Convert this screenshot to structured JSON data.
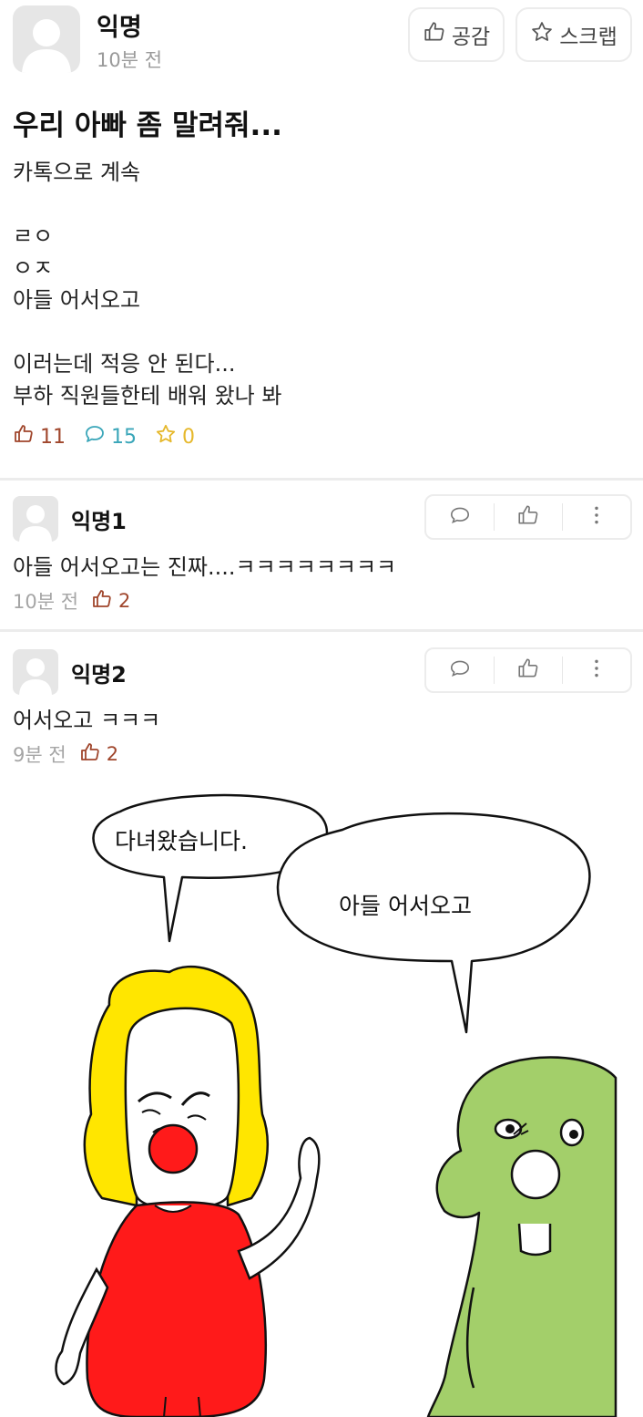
{
  "post": {
    "author": "익명",
    "time": "10분 전",
    "like_button": "공감",
    "scrap_button": "스크랩",
    "title": "우리 아빠 좀 말려줘...",
    "body_lines": [
      "카톡으로 계속",
      "",
      "ㄹㅇ",
      "ㅇㅈ",
      "아들 어서오고",
      "",
      "이러는데 적응 안 된다...",
      "부하 직원들한테 배워 왔나 봐"
    ],
    "stats": {
      "likes": "11",
      "comments": "15",
      "scraps": "0"
    }
  },
  "comments": [
    {
      "author": "익명1",
      "text": "아들 어서오고는 진짜....ㅋㅋㅋㅋㅋㅋㅋㅋ",
      "time": "10분 전",
      "likes": "2"
    },
    {
      "author": "익명2",
      "text": "어서오고 ㅋㅋㅋ",
      "time": "9분 전",
      "likes": "2"
    }
  ],
  "comic": {
    "bubble_left": "다녀왔습니다.",
    "bubble_right": "아들 어서오고"
  },
  "colors": {
    "like": "#a0462c",
    "comment": "#3aa6b9",
    "scrap": "#e6b82b",
    "divider": "#ececec",
    "hair": "#ffe600",
    "dress": "#ff1a1a",
    "green": "#a3cf6a"
  },
  "icons": [
    "user-avatar-icon",
    "thumbs-up-icon",
    "star-icon",
    "speech-bubble-icon",
    "more-vertical-icon"
  ]
}
